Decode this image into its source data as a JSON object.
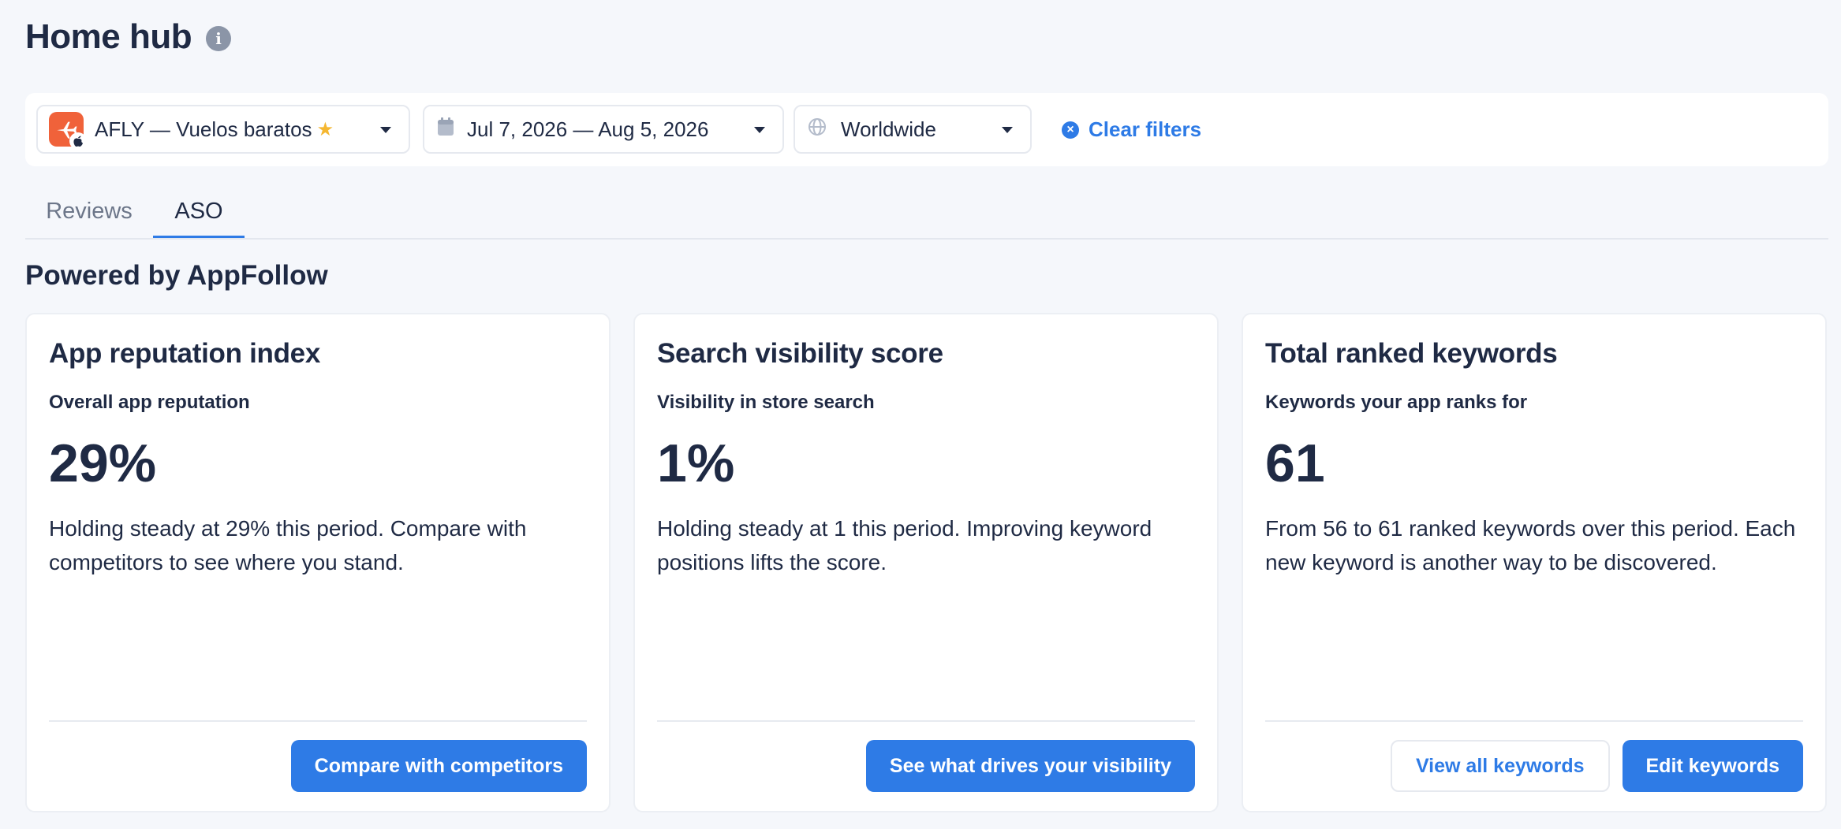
{
  "header": {
    "title": "Home hub",
    "info_icon": "info-icon"
  },
  "filters": {
    "app": {
      "name": "AFLY — Vuelos baratos",
      "icon": "plane-icon",
      "platform_icon": "apple-icon",
      "favorite_icon": "star-icon"
    },
    "date_range": {
      "value": "Jul 7, 2026 — Aug 5, 2026",
      "icon": "calendar-icon"
    },
    "region": {
      "value": "Worldwide",
      "icon": "globe-icon"
    },
    "clear_label": "Clear filters"
  },
  "tabs": [
    {
      "label": "Reviews",
      "active": false
    },
    {
      "label": "ASO",
      "active": true
    }
  ],
  "section": {
    "title": "Powered by AppFollow"
  },
  "cards": [
    {
      "title": "App reputation index",
      "subtitle": "Overall app reputation",
      "value": "29%",
      "description": "Holding steady at 29% this period. Compare with competitors to see where you stand.",
      "buttons": [
        {
          "label": "Compare with competitors",
          "style": "primary"
        }
      ]
    },
    {
      "title": "Search visibility score",
      "subtitle": "Visibility in store search",
      "value": "1%",
      "description": "Holding steady at 1 this period. Improving keyword positions lifts the score.",
      "buttons": [
        {
          "label": "See what drives your visibility",
          "style": "primary"
        }
      ]
    },
    {
      "title": "Total ranked keywords",
      "subtitle": "Keywords your app ranks for",
      "value": "61",
      "description": "From 56 to 61 ranked keywords over this period. Each new keyword is another way to be discovered.",
      "buttons": [
        {
          "label": "View all keywords",
          "style": "secondary"
        },
        {
          "label": "Edit keywords",
          "style": "primary"
        }
      ]
    }
  ],
  "colors": {
    "accent": "#2e7be6",
    "text": "#1f2a44",
    "background": "#f5f7fb",
    "app_icon": "#f0623a",
    "star": "#f5b731"
  }
}
